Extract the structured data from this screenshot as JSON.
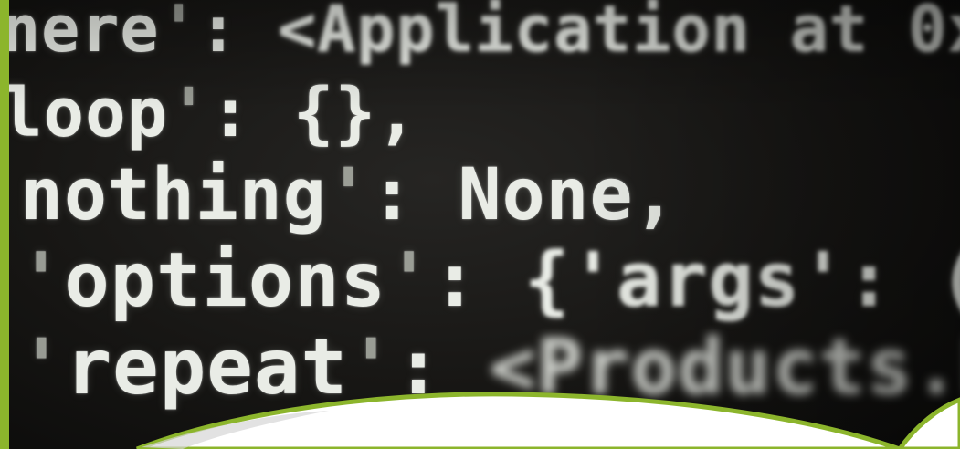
{
  "code_lines": [
    {
      "key": "nere",
      "sep": ": ",
      "value": "<Application at 0x"
    },
    {
      "key": "loop",
      "sep": ": ",
      "value": "{},"
    },
    {
      "key": "nothing",
      "sep": ": ",
      "value": "None,"
    },
    {
      "key": "options",
      "sep": ": ",
      "value": "{'args': ()},"
    },
    {
      "key": "repeat",
      "sep": ": ",
      "value": "<Products.PageT"
    }
  ],
  "colors": {
    "accent_green": "#8cb52c",
    "text": "#e9ece6",
    "background": "#171614"
  }
}
